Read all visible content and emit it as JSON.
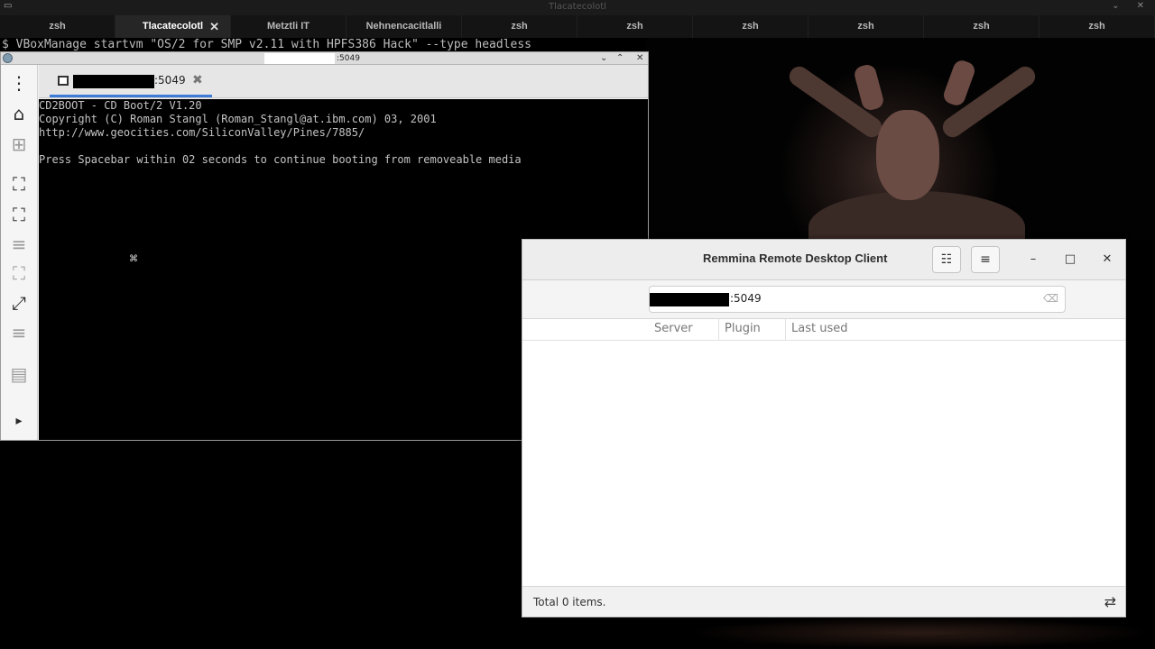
{
  "terminal": {
    "title": "Tlacatecolotl",
    "menu_icon": "terminal-menu-icon",
    "wm_buttons": "⌄ ✕",
    "tabs": [
      {
        "label": "zsh",
        "active": false
      },
      {
        "label": "Tlacatecolotl",
        "active": true,
        "close": "✕"
      },
      {
        "label": "Metztli IT",
        "active": false
      },
      {
        "label": "Nehnencacitlalli",
        "active": false
      },
      {
        "label": "zsh",
        "active": false
      },
      {
        "label": "zsh",
        "active": false
      },
      {
        "label": "zsh",
        "active": false
      },
      {
        "label": "zsh",
        "active": false
      },
      {
        "label": "zsh",
        "active": false
      },
      {
        "label": "zsh",
        "active": false
      }
    ],
    "command": "$ VBoxManage startvm \"OS/2 for SMP v2.11 with HPFS386 Hack\" --type headless"
  },
  "connection_window": {
    "title_suffix": ":5049",
    "tab_label_suffix": ":5049",
    "tab_close": "✖",
    "window_buttons": {
      "shade": "⌄",
      "maximize": "⌃",
      "close": "✕"
    },
    "screen_lines": [
      "CD2BOOT - CD Boot/2 V1.20",
      "Copyright (C) Roman Stangl (Roman_Stangl@at.ibm.com) 03, 2001",
      "http://www.geocities.com/SiliconValley/Pines/7885/",
      "",
      "Press Spacebar within 02 seconds to continue booting from removeable media"
    ],
    "cursor_glyph": "⌘",
    "toolbar": [
      {
        "icon": "more-vertical-icon",
        "glyph": "⋮"
      },
      {
        "icon": "home-icon",
        "glyph": "⌂"
      },
      {
        "icon": "new-tab-icon",
        "glyph": "⊞"
      },
      {
        "icon": "fit-window-icon",
        "glyph": "⛶"
      },
      {
        "icon": "fullscreen-icon",
        "glyph": "⛶"
      },
      {
        "icon": "menu-icon",
        "glyph": "≡"
      },
      {
        "icon": "scale-icon",
        "glyph": "⛶"
      },
      {
        "icon": "dynamic-resolution-icon",
        "glyph": "⤢"
      },
      {
        "icon": "menu-icon",
        "glyph": "≡"
      },
      {
        "icon": "screenshot-icon",
        "glyph": "▤"
      },
      {
        "icon": "expand-icon",
        "glyph": "▸"
      }
    ]
  },
  "main_window": {
    "title": "Remmina Remote Desktop Client",
    "view_toggle_glyph": "☷",
    "hamburger_glyph": "≡",
    "wm": {
      "minimize": "–",
      "maximize": "□",
      "close": "✕"
    },
    "search": {
      "value_suffix": ":5049",
      "clear_glyph": "⌫"
    },
    "columns": [
      "Server",
      "Plugin",
      "Last used"
    ],
    "status": "Total 0 items.",
    "swap_glyph": "⇄"
  }
}
